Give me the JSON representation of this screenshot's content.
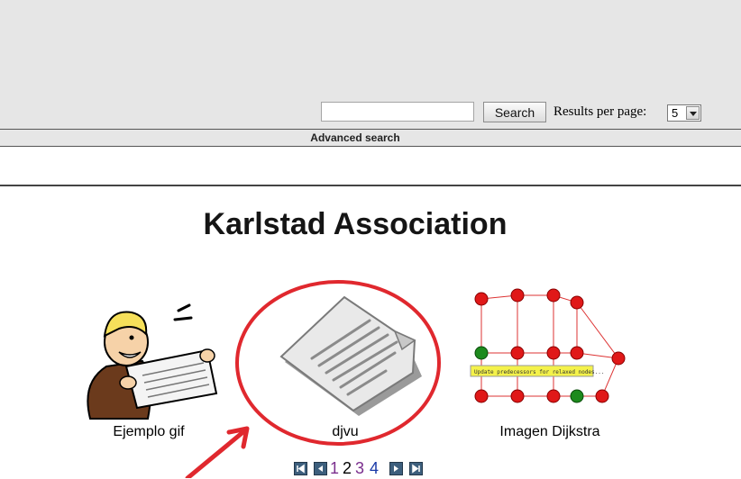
{
  "search": {
    "input_value": "",
    "button_label": "Search",
    "results_label": "Results per page:",
    "results_value": "5"
  },
  "advanced_search_label": "Advanced search",
  "page_title": "Karlstad Association",
  "gallery": {
    "items": [
      {
        "caption": "Ejemplo gif",
        "icon": "reading-man-cartoon"
      },
      {
        "caption": "djvu",
        "icon": "document-icon"
      },
      {
        "caption": "Imagen Dijkstra",
        "icon": "graph-diagram"
      }
    ]
  },
  "pagination": {
    "pages": [
      "1",
      "2",
      "3",
      "4"
    ],
    "current_page": "2",
    "colors": {
      "visited": "#7b2f8e",
      "current": "#000000",
      "link": "#1a3aa8"
    }
  },
  "annotation_color": "#e0282e",
  "graph_tooltip": "Update predecessors for relaxed nodes..."
}
